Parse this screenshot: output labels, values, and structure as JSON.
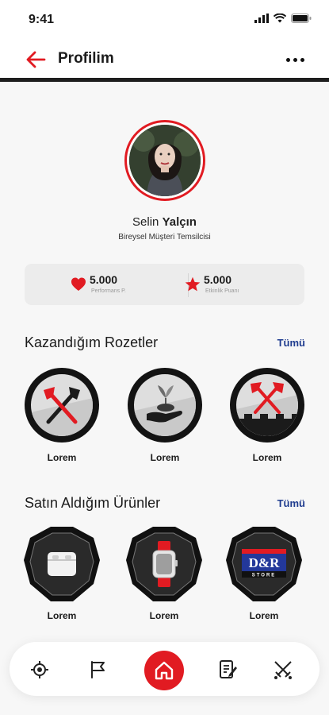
{
  "status_bar": {
    "time": "9:41"
  },
  "header": {
    "title": "Profilim"
  },
  "profile": {
    "first_name": "Selin",
    "last_name": "Yalçın",
    "role": "Bireysel Müşteri Temsilcisi"
  },
  "stats": [
    {
      "value": "5.000",
      "label": "Performans P.",
      "icon": "heart-icon"
    },
    {
      "value": "5.000",
      "label": "Etkinlik Puanı",
      "icon": "star-icon"
    }
  ],
  "badges_section": {
    "title": "Kazandığım Rozetler",
    "see_all": "Tümü",
    "items": [
      {
        "label": "Lorem",
        "icon": "crossed-axes-icon"
      },
      {
        "label": "Lorem",
        "icon": "hand-plant-icon"
      },
      {
        "label": "Lorem",
        "icon": "castle-axes-icon"
      }
    ]
  },
  "products_section": {
    "title": "Satın Aldığım Ürünler",
    "see_all": "Tümü",
    "items": [
      {
        "label": "Lorem",
        "icon": "earbuds-case-icon"
      },
      {
        "label": "Lorem",
        "icon": "smartwatch-icon"
      },
      {
        "label": "Lorem",
        "icon": "dr-store-logo"
      }
    ]
  },
  "bottom_nav": [
    {
      "icon": "target-icon"
    },
    {
      "icon": "flag-icon"
    },
    {
      "icon": "home-icon",
      "active": true
    },
    {
      "icon": "document-edit-icon"
    },
    {
      "icon": "crossed-swords-icon"
    }
  ],
  "logo_text": {
    "brand": "D&R",
    "sub": "STORE"
  },
  "colors": {
    "accent": "#e11b22",
    "link": "#1f3c8f",
    "card": "#ececec",
    "badge_ring": "#131313"
  }
}
